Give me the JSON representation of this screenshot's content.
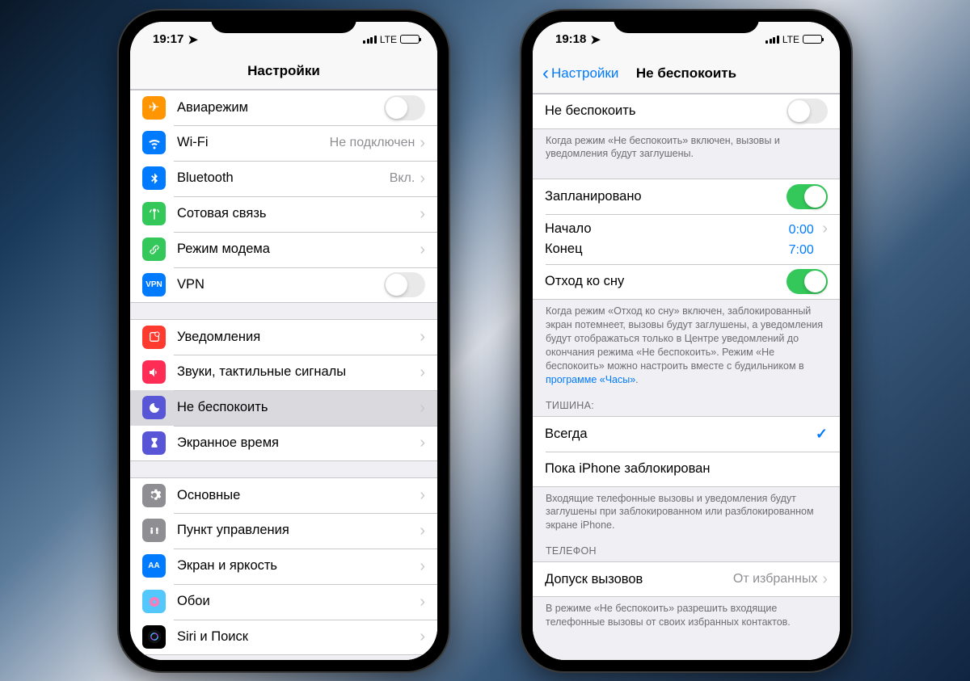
{
  "phoneA": {
    "time": "19:17",
    "network": "LTE",
    "title": "Настройки",
    "groups": [
      {
        "items": [
          {
            "id": "airplane",
            "label": "Авиарежим",
            "control": "switch",
            "icon_bg": "#ff9500",
            "icon": "✈"
          },
          {
            "id": "wifi",
            "label": "Wi-Fi",
            "value": "Не подключен",
            "control": "disclose",
            "icon_bg": "#007aff",
            "icon": "wifi"
          },
          {
            "id": "bluetooth",
            "label": "Bluetooth",
            "value": "Вкл.",
            "control": "disclose",
            "icon_bg": "#007aff",
            "icon": "bt"
          },
          {
            "id": "cell",
            "label": "Сотовая связь",
            "control": "disclose",
            "icon_bg": "#34c759",
            "icon": "ant"
          },
          {
            "id": "hotspot",
            "label": "Режим модема",
            "control": "disclose",
            "icon_bg": "#34c759",
            "icon": "link"
          },
          {
            "id": "vpn",
            "label": "VPN",
            "control": "switch",
            "icon_bg": "#007aff",
            "icon": "VPN",
            "icon_text": true
          }
        ]
      },
      {
        "items": [
          {
            "id": "notif",
            "label": "Уведомления",
            "control": "disclose",
            "icon_bg": "#ff3b30",
            "icon": "notif"
          },
          {
            "id": "sounds",
            "label": "Звуки, тактильные сигналы",
            "control": "disclose",
            "icon_bg": "#ff2d55",
            "icon": "sound"
          },
          {
            "id": "dnd",
            "label": "Не беспокоить",
            "control": "disclose",
            "icon_bg": "#5856d6",
            "icon": "moon",
            "selected": true
          },
          {
            "id": "screentime",
            "label": "Экранное время",
            "control": "disclose",
            "icon_bg": "#5856d6",
            "icon": "hourglass"
          }
        ]
      },
      {
        "items": [
          {
            "id": "general",
            "label": "Основные",
            "control": "disclose",
            "icon_bg": "#8e8e93",
            "icon": "gear"
          },
          {
            "id": "control",
            "label": "Пункт управления",
            "control": "disclose",
            "icon_bg": "#8e8e93",
            "icon": "cc"
          },
          {
            "id": "display",
            "label": "Экран и яркость",
            "control": "disclose",
            "icon_bg": "#007aff",
            "icon": "AA",
            "icon_text": true
          },
          {
            "id": "wallpaper",
            "label": "Обои",
            "control": "disclose",
            "icon_bg": "#54c7fc",
            "icon": "wall"
          },
          {
            "id": "siri",
            "label": "Siri и Поиск",
            "control": "disclose",
            "icon_bg": "#000",
            "icon": "siri"
          }
        ]
      }
    ]
  },
  "phoneB": {
    "time": "19:18",
    "network": "LTE",
    "back": "Настройки",
    "title": "Не беспокоить",
    "sec1": {
      "dnd_label": "Не беспокоить",
      "dnd_on": false,
      "footer": "Когда режим «Не беспокоить» включен, вызовы и уведомления будут заглушены."
    },
    "sec2": {
      "sched_label": "Запланировано",
      "sched_on": true,
      "from_label": "Начало",
      "from_val": "0:00",
      "to_label": "Конец",
      "to_val": "7:00",
      "bedtime_label": "Отход ко сну",
      "bedtime_on": true,
      "footer_pre": "Когда режим «Отход ко сну» включен, заблокированный экран потемнеет, вызовы будут заглушены, а уведомления будут отображаться только в Центре уведомлений до окончания режима «Не беспокоить». Режим «Не беспокоить» можно настроить вместе с будильником в ",
      "footer_link": "программе «Часы»",
      "footer_post": "."
    },
    "sec3": {
      "header": "ТИШИНА:",
      "opt1": "Всегда",
      "opt1_checked": true,
      "opt2": "Пока iPhone заблокирован",
      "footer": "Входящие телефонные вызовы и уведомления будут заглушены при заблокированном или разблокированном экране iPhone."
    },
    "sec4": {
      "header": "ТЕЛЕФОН",
      "allow_label": "Допуск вызовов",
      "allow_val": "От избранных",
      "footer": "В режиме «Не беспокоить» разрешить входящие телефонные вызовы от своих избранных контактов."
    }
  }
}
